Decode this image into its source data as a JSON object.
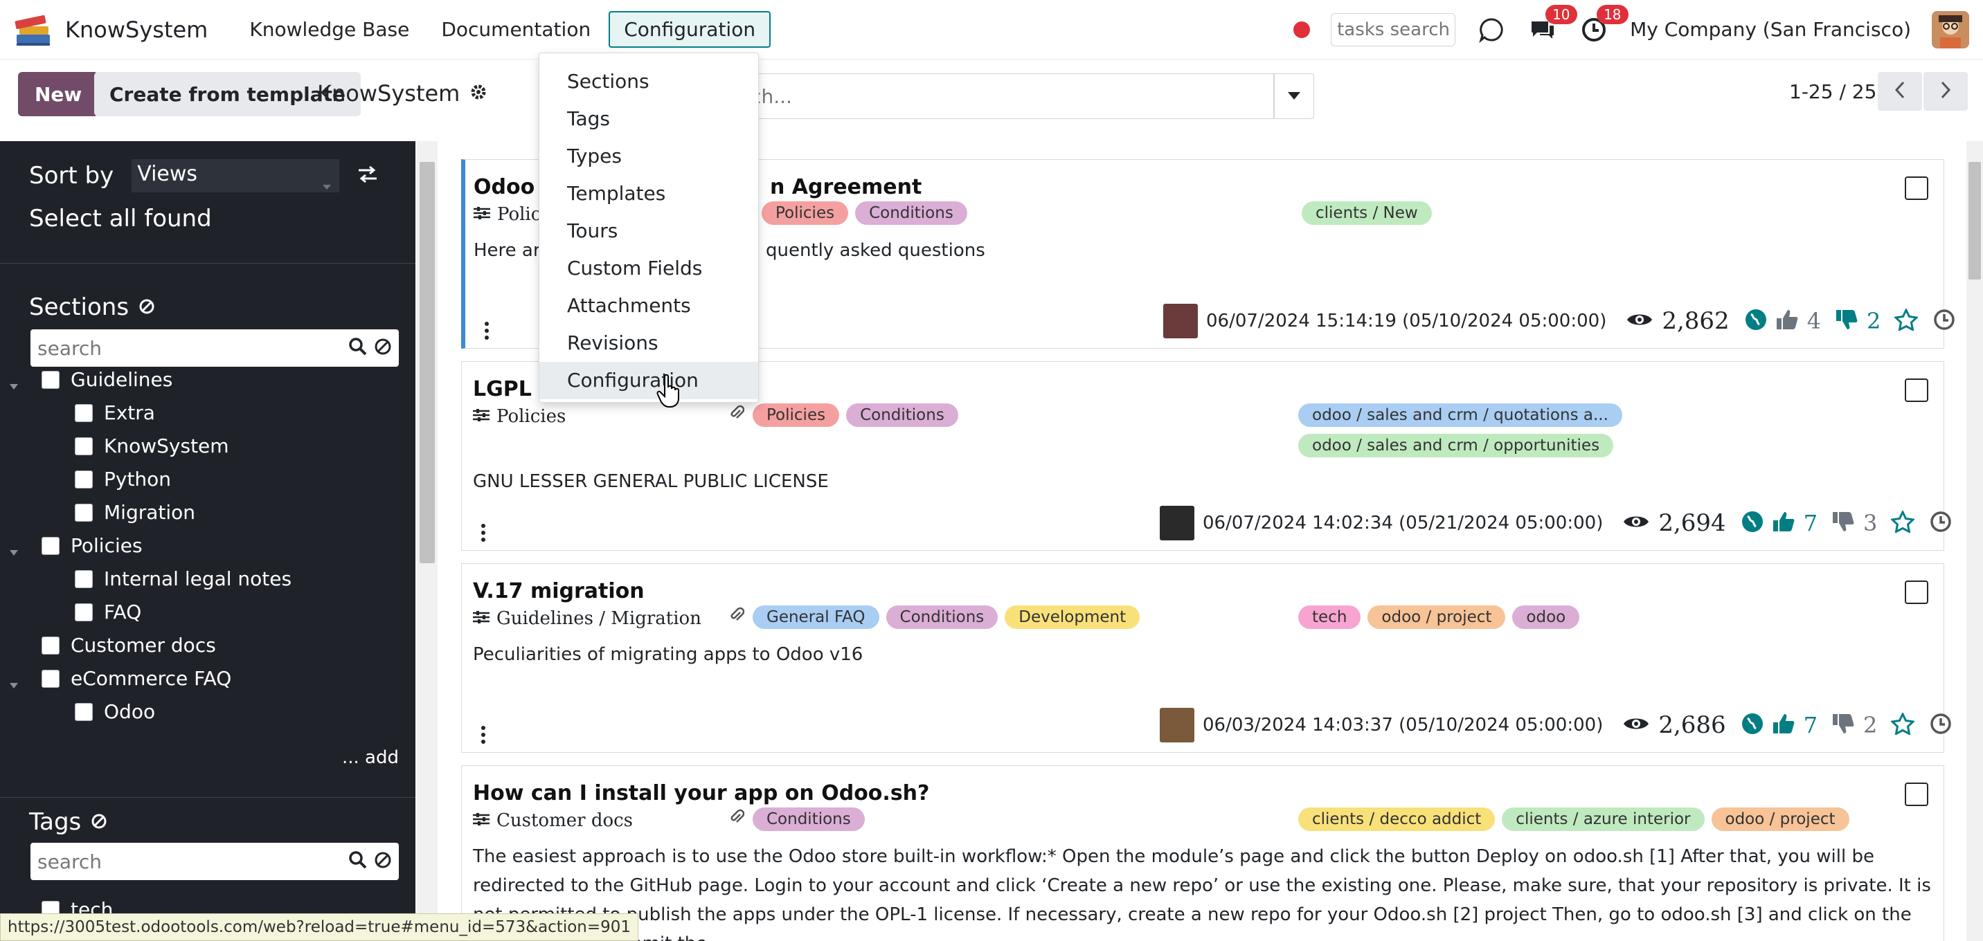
{
  "app": {
    "name": "KnowSystem"
  },
  "navbar": {
    "items": [
      "Knowledge Base",
      "Documentation",
      "Configuration"
    ],
    "active": "Configuration",
    "tasks_search_placeholder": "tasks search",
    "messages_badge": "10",
    "activities_badge": "18",
    "company": "My Company (San Francisco)"
  },
  "control": {
    "new_label": "New",
    "template_label": "Create from template",
    "breadcrumb": "KnowSystem",
    "search_placeholder": "Search...",
    "pager": "1-25 / 25"
  },
  "config_menu": {
    "items": [
      "Sections",
      "Tags",
      "Types",
      "Templates",
      "Tours",
      "Custom Fields",
      "Attachments",
      "Revisions",
      "Configuration"
    ],
    "hovered": "Configuration"
  },
  "sidebar": {
    "sort_label": "Sort by",
    "sort_value": "Views",
    "select_all": "Select all found",
    "sections_title": "Sections",
    "search_placeholder": "search",
    "sections": [
      {
        "label": "Guidelines",
        "level": 0
      },
      {
        "label": "Extra",
        "level": 1
      },
      {
        "label": "KnowSystem",
        "level": 1
      },
      {
        "label": "Python",
        "level": 1
      },
      {
        "label": "Migration",
        "level": 1
      },
      {
        "label": "Policies",
        "level": 0
      },
      {
        "label": "Internal legal notes",
        "level": 1
      },
      {
        "label": "FAQ",
        "level": 1
      },
      {
        "label": "Customer docs",
        "level": 0
      },
      {
        "label": "eCommerce FAQ",
        "level": 0
      },
      {
        "label": "Odoo",
        "level": 1
      }
    ],
    "add_link": "... add",
    "tags_title": "Tags",
    "tags_search_placeholder": "search",
    "tags": [
      {
        "label": "tech"
      }
    ]
  },
  "articles": [
    {
      "title": "Odoo License Agreement",
      "title_visible_left": "Odoo I",
      "title_visible_right": "n Agreement",
      "section_visible": "Polici",
      "tags": [
        "Policies",
        "Conditions"
      ],
      "right_tags": [
        "clients / New"
      ],
      "description_left": "Here are",
      "description_right": "quently asked questions",
      "date": "06/07/2024 15:14:19 (05/10/2024 05:00:00)",
      "views": "2,862",
      "likes": "4",
      "dislikes": "2"
    },
    {
      "title_visible_left": "LGPL v",
      "section": "Policies",
      "tags": [
        "Policies",
        "Conditions"
      ],
      "right_tags": [
        "odoo / sales and crm / quotations a...",
        "odoo / sales and crm / opportunities"
      ],
      "description": "GNU LESSER GENERAL PUBLIC LICENSE",
      "date": "06/07/2024 14:02:34 (05/21/2024 05:00:00)",
      "views": "2,694",
      "likes": "7",
      "dislikes": "3"
    },
    {
      "title": "V.17 migration",
      "section": "Guidelines / Migration",
      "tags": [
        "General FAQ",
        "Conditions",
        "Development"
      ],
      "right_tags": [
        "tech",
        "odoo / project",
        "odoo"
      ],
      "description": "Peculiarities of migrating apps to Odoo v16",
      "date": "06/03/2024 14:03:37 (05/10/2024 05:00:00)",
      "views": "2,686",
      "likes": "7",
      "dislikes": "2"
    },
    {
      "title": "How can I install your app on Odoo.sh?",
      "section": "Customer docs",
      "tags": [
        "Conditions"
      ],
      "right_tags": [
        "clients / decco addict",
        "clients / azure interior",
        "odoo / project"
      ],
      "description": "The easiest approach is to use the Odoo store built-in workflow:* Open the module’s page and click the button Deploy on odoo.sh [1] After that, you will be redirected to the GitHub page. Login to your account and click ‘Create a new repo’ or use the existing one. Please, make sure, that your repository is private. It is not permitted to publish the apps under the OPL-1 license. If necessary, create a new repo for your Odoo.sh [2] project Then, go to odoo.sh [3] and click on the deploy button, submit the"
    }
  ],
  "status_url": "https://3005test.odootools.com/web?reload=true#menu_id=573&action=901",
  "colors": {
    "brand": "#714b67",
    "teal": "#017e84",
    "sidebar": "#1f2329",
    "badge": "#e0303a"
  }
}
